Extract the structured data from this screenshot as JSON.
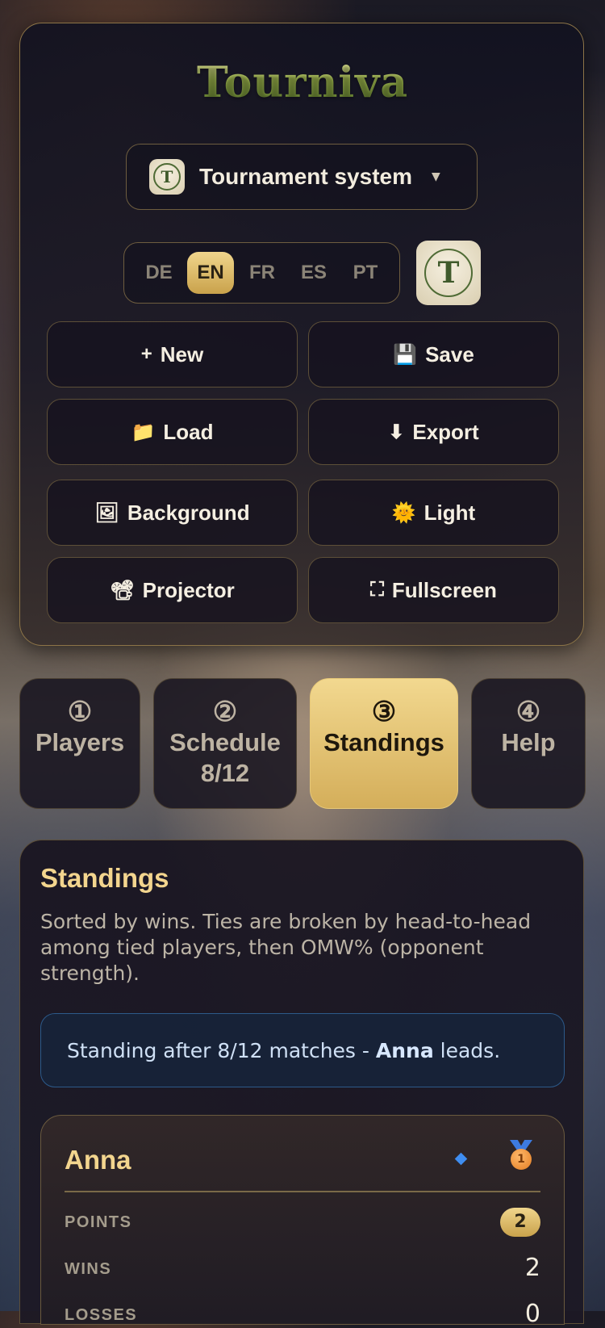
{
  "app": {
    "title": "Tourniva",
    "system_label": "Tournament system",
    "emblem_letter": "T"
  },
  "languages": [
    {
      "code": "DE",
      "active": false
    },
    {
      "code": "EN",
      "active": true
    },
    {
      "code": "FR",
      "active": false
    },
    {
      "code": "ES",
      "active": false
    },
    {
      "code": "PT",
      "active": false
    }
  ],
  "toolbar": {
    "new": {
      "icon": "+",
      "label": "New"
    },
    "save": {
      "icon": "💾",
      "label": "Save"
    },
    "load": {
      "icon": "📁",
      "label": "Load"
    },
    "export": {
      "icon": "⬇",
      "label": "Export"
    },
    "background": {
      "icon": "🖼",
      "label": "Background"
    },
    "light": {
      "icon": "🌞",
      "label": "Light"
    },
    "projector": {
      "icon": "📽",
      "label": "Projector"
    },
    "fullscreen": {
      "icon": "⛶",
      "label": "Fullscreen"
    }
  },
  "tabs": [
    {
      "num": "①",
      "label": "Players",
      "sub": "",
      "active": false
    },
    {
      "num": "②",
      "label": "Schedule",
      "sub": "8/12",
      "active": false
    },
    {
      "num": "③",
      "label": "Standings",
      "sub": "",
      "active": true
    },
    {
      "num": "④",
      "label": "Help",
      "sub": "",
      "active": false
    }
  ],
  "standings": {
    "title": "Standings",
    "description": "Sorted by wins. Ties are broken by head-to-head among tied players, then OMW% (opponent strength).",
    "info_prefix": "Standing after 8/12 matches - ",
    "info_leader": "Anna",
    "info_suffix": " leads.",
    "players": [
      {
        "name": "Anna",
        "medal": "1",
        "points_label": "POINTS",
        "points": "2",
        "wins_label": "WINS",
        "wins": "2",
        "losses_label": "LOSSES",
        "losses": "0"
      }
    ]
  },
  "colors": {
    "accent_gold": "#f3d58e",
    "info_blue": "#2c5a8a",
    "diamond_blue": "#3f8df0"
  }
}
